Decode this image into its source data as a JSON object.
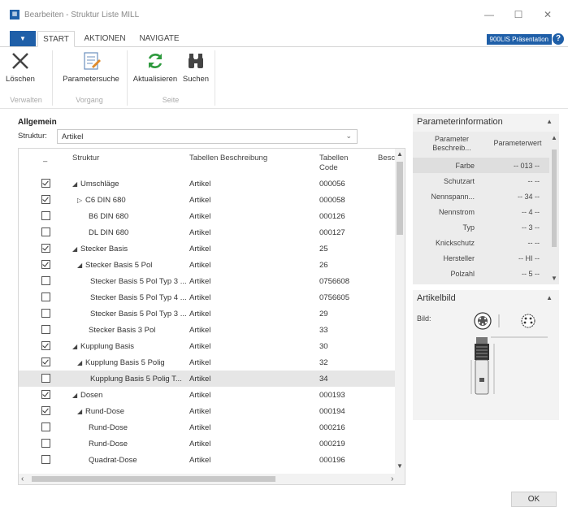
{
  "window": {
    "title": "Bearbeiten - Struktur Liste MILL",
    "minimize": "—",
    "maximize": "☐",
    "close": "✕"
  },
  "ribbon_tabs": {
    "file": "▼",
    "start": "START",
    "aktionen": "AKTIONEN",
    "navigate": "NAVIGATE",
    "badge": "900LIS Präsentation",
    "help": "?"
  },
  "ribbon": {
    "loeschen": "Löschen",
    "parametersuche": "Parametersuche",
    "aktualisieren": "Aktualisieren",
    "suchen": "Suchen",
    "group_verwalten": "Verwalten",
    "group_vorgang": "Vorgang",
    "group_seite": "Seite"
  },
  "main": {
    "section": "Allgemein",
    "struktur_label": "Struktur:",
    "struktur_value": "Artikel"
  },
  "grid": {
    "headers": {
      "check": "–",
      "struktur": "Struktur",
      "beschreibung": "Tabellen Beschreibung",
      "code_line1": "Tabellen",
      "code_line2": "Code",
      "besc": "Besc"
    },
    "rows": [
      {
        "checked": true,
        "level": 1,
        "expander": "◢",
        "name": "Umschläge",
        "desc": "Artikel",
        "code": "000056",
        "selected": false
      },
      {
        "checked": true,
        "level": 2,
        "expander": "▷",
        "name": "C6 DIN 680",
        "desc": "Artikel",
        "code": "000058",
        "selected": false
      },
      {
        "checked": false,
        "level": 3,
        "expander": "",
        "name": "B6 DIN 680",
        "desc": "Artikel",
        "code": "000126",
        "selected": false
      },
      {
        "checked": false,
        "level": 3,
        "expander": "",
        "name": "DL DIN 680",
        "desc": "Artikel",
        "code": "000127",
        "selected": false
      },
      {
        "checked": true,
        "level": 1,
        "expander": "◢",
        "name": "Stecker Basis",
        "desc": "Artikel",
        "code": "25",
        "selected": false
      },
      {
        "checked": true,
        "level": 2,
        "expander": "◢",
        "name": "Stecker Basis 5 Pol",
        "desc": "Artikel",
        "code": "26",
        "selected": false
      },
      {
        "checked": false,
        "level": 4,
        "expander": "",
        "name": "Stecker Basis 5 Pol Typ 3 ...",
        "desc": "Artikel",
        "code": "0756608",
        "selected": false
      },
      {
        "checked": false,
        "level": 4,
        "expander": "",
        "name": "Stecker Basis 5 Pol Typ 4 ...",
        "desc": "Artikel",
        "code": "0756605",
        "selected": false
      },
      {
        "checked": false,
        "level": 4,
        "expander": "",
        "name": "Stecker Basis 5 Pol Typ 3 ...",
        "desc": "Artikel",
        "code": "29",
        "selected": false
      },
      {
        "checked": false,
        "level": 3,
        "expander": "",
        "name": "Stecker Basis 3 Pol",
        "desc": "Artikel",
        "code": "33",
        "selected": false
      },
      {
        "checked": true,
        "level": 1,
        "expander": "◢",
        "name": "Kupplung Basis",
        "desc": "Artikel",
        "code": "30",
        "selected": false
      },
      {
        "checked": true,
        "level": 2,
        "expander": "◢",
        "name": "Kupplung Basis 5 Polig",
        "desc": "Artikel",
        "code": "32",
        "selected": false
      },
      {
        "checked": false,
        "level": 4,
        "expander": "",
        "name": "Kupplung Basis 5 Polig T...",
        "desc": "Artikel",
        "code": "34",
        "selected": true
      },
      {
        "checked": true,
        "level": 1,
        "expander": "◢",
        "name": "Dosen",
        "desc": "Artikel",
        "code": "000193",
        "selected": false
      },
      {
        "checked": true,
        "level": 2,
        "expander": "◢",
        "name": "Rund-Dose",
        "desc": "Artikel",
        "code": "000194",
        "selected": false
      },
      {
        "checked": false,
        "level": 3,
        "expander": "",
        "name": "Rund-Dose",
        "desc": "Artikel",
        "code": "000216",
        "selected": false
      },
      {
        "checked": false,
        "level": 3,
        "expander": "",
        "name": "Rund-Dose",
        "desc": "Artikel",
        "code": "000219",
        "selected": false
      },
      {
        "checked": false,
        "level": 3,
        "expander": "",
        "name": "Quadrat-Dose",
        "desc": "Artikel",
        "code": "000196",
        "selected": false
      }
    ]
  },
  "param_panel": {
    "title": "Parameterinformation",
    "col_name_line1": "Parameter",
    "col_name_line2": "Beschreib...",
    "col_value": "Parameterwert",
    "rows": [
      {
        "name": "Farbe",
        "value": "-- 013 --",
        "selected": true
      },
      {
        "name": "Schutzart",
        "value": "-- --",
        "selected": false
      },
      {
        "name": "Nennspann...",
        "value": "-- 34 --",
        "selected": false
      },
      {
        "name": "Nennstrom",
        "value": "-- 4 --",
        "selected": false
      },
      {
        "name": "Typ",
        "value": "-- 3 --",
        "selected": false
      },
      {
        "name": "Knickschutz",
        "value": "-- --",
        "selected": false
      },
      {
        "name": "Hersteller",
        "value": "-- HI --",
        "selected": false
      },
      {
        "name": "Polzahl",
        "value": "-- 5 --",
        "selected": false
      }
    ]
  },
  "bild_panel": {
    "title": "Artikelbild",
    "label": "Bild:"
  },
  "footer": {
    "ok": "OK"
  },
  "colors": {
    "accent": "#1f5fa8",
    "selected_row": "#e6e6e6",
    "panel_bg": "#f3f3f3"
  }
}
